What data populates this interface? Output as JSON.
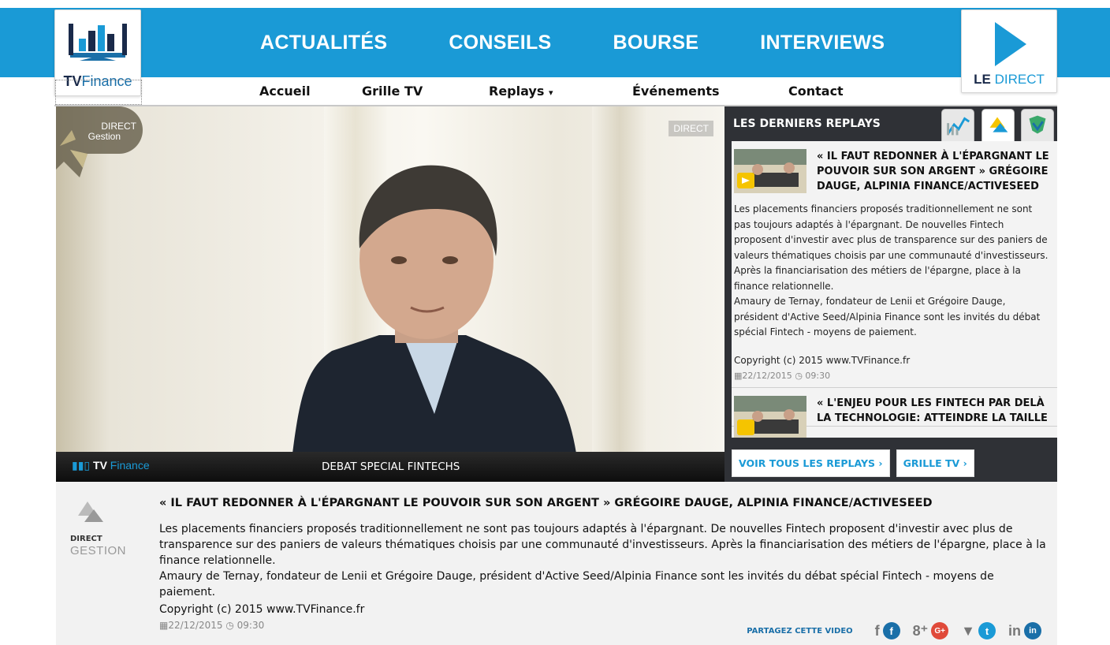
{
  "header": {
    "logo_prefix": "TV",
    "logo_suffix": "Finance",
    "main_nav": [
      "ACTUALITÉS",
      "CONSEILS",
      "BOURSE",
      "INTERVIEWS"
    ],
    "direct_prefix": "LE",
    "direct_suffix": "DIRECT",
    "sub_nav": {
      "accueil": "Accueil",
      "grille": "Grille TV",
      "replays": "Replays ",
      "replays_caret": "▾",
      "evenements": "Événements",
      "contact": "Contact"
    }
  },
  "video": {
    "badge_line1": "DIRECT",
    "badge_line2": "Gestion",
    "direct_tag": "DIRECT",
    "logo_prefix": "TV",
    "logo_suffix": "Finance",
    "caption": "DEBAT SPECIAL FINTECHS"
  },
  "panel": {
    "title": "LES DERNIERS REPLAYS",
    "items": [
      {
        "title": "« IL FAUT REDONNER À L'ÉPARGNANT LE POUVOIR SUR SON ARGENT  » GRÉGOIRE DAUGE, ALPINIA FINANCE/ACTIVESEED",
        "desc": "Les placements financiers proposés traditionnellement ne sont pas toujours adaptés à l'épargnant. De nouvelles Fintech proposent d'investir avec plus de transparence sur des paniers de valeurs thématiques choisis par une communauté d'investisseurs. Après la financiarisation des métiers de l'épargne, place à la finance relationnelle.\nAmaury de Ternay, fondateur de Lenii et Grégoire Dauge, président d'Active Seed/Alpinia Finance sont les invités du débat spécial Fintech - moyens de paiement.",
        "copyright": "Copyright (c) 2015 www.TVFinance.fr",
        "date": "22/12/2015",
        "time": "09:30"
      },
      {
        "title": "« L'ENJEU POUR LES FINTECH PAR DELÀ LA TECHNOLOGIE: ATTEINDRE LA TAILLE"
      }
    ],
    "btn_all": "VOIR TOUS LES REPLAYS",
    "btn_grille": "GRILLE TV"
  },
  "description": {
    "logo_line1": "DIRECT",
    "logo_line2": "GESTION",
    "title": "« IL FAUT REDONNER À L'ÉPARGNANT LE POUVOIR SUR SON ARGENT  » GRÉGOIRE DAUGE, ALPINIA FINANCE/ACTIVESEED",
    "text1": "Les placements financiers proposés traditionnellement ne sont pas toujours adaptés à l'épargnant. De nouvelles Fintech proposent d'investir avec plus de transparence sur des paniers de valeurs thématiques choisis par une communauté d'investisseurs. Après la financiarisation des métiers de l'épargne, place à la finance relationnelle.",
    "text2": "Amaury de Ternay, fondateur de Lenii et Grégoire Dauge, président d'Active Seed/Alpinia Finance sont les invités du débat spécial Fintech - moyens de paiement.",
    "copyright": "Copyright (c) 2015 www.TVFinance.fr",
    "date": "22/12/2015",
    "time": "09:30",
    "share_label": "PARTAGEZ CETTE VIDEO",
    "share": [
      {
        "name": "facebook",
        "glyph": "f",
        "badge": "f",
        "color": "#1a6fa8"
      },
      {
        "name": "googleplus",
        "glyph": "8⁺",
        "badge": "G+",
        "color": "#e04a3a"
      },
      {
        "name": "twitter",
        "glyph": "🐦",
        "badge": "t",
        "color": "#1a9ad6"
      },
      {
        "name": "linkedin",
        "glyph": "in",
        "badge": "in",
        "color": "#1a6fa8"
      }
    ]
  },
  "colors": {
    "brand_blue": "#1a9ad6",
    "panel_dark": "#2f3136",
    "accent_yellow": "#f5c400"
  },
  "icons": {
    "calendar": "calendar-icon",
    "clock": "clock-icon",
    "chevron": "chevron-right-icon",
    "play": "play-icon"
  }
}
